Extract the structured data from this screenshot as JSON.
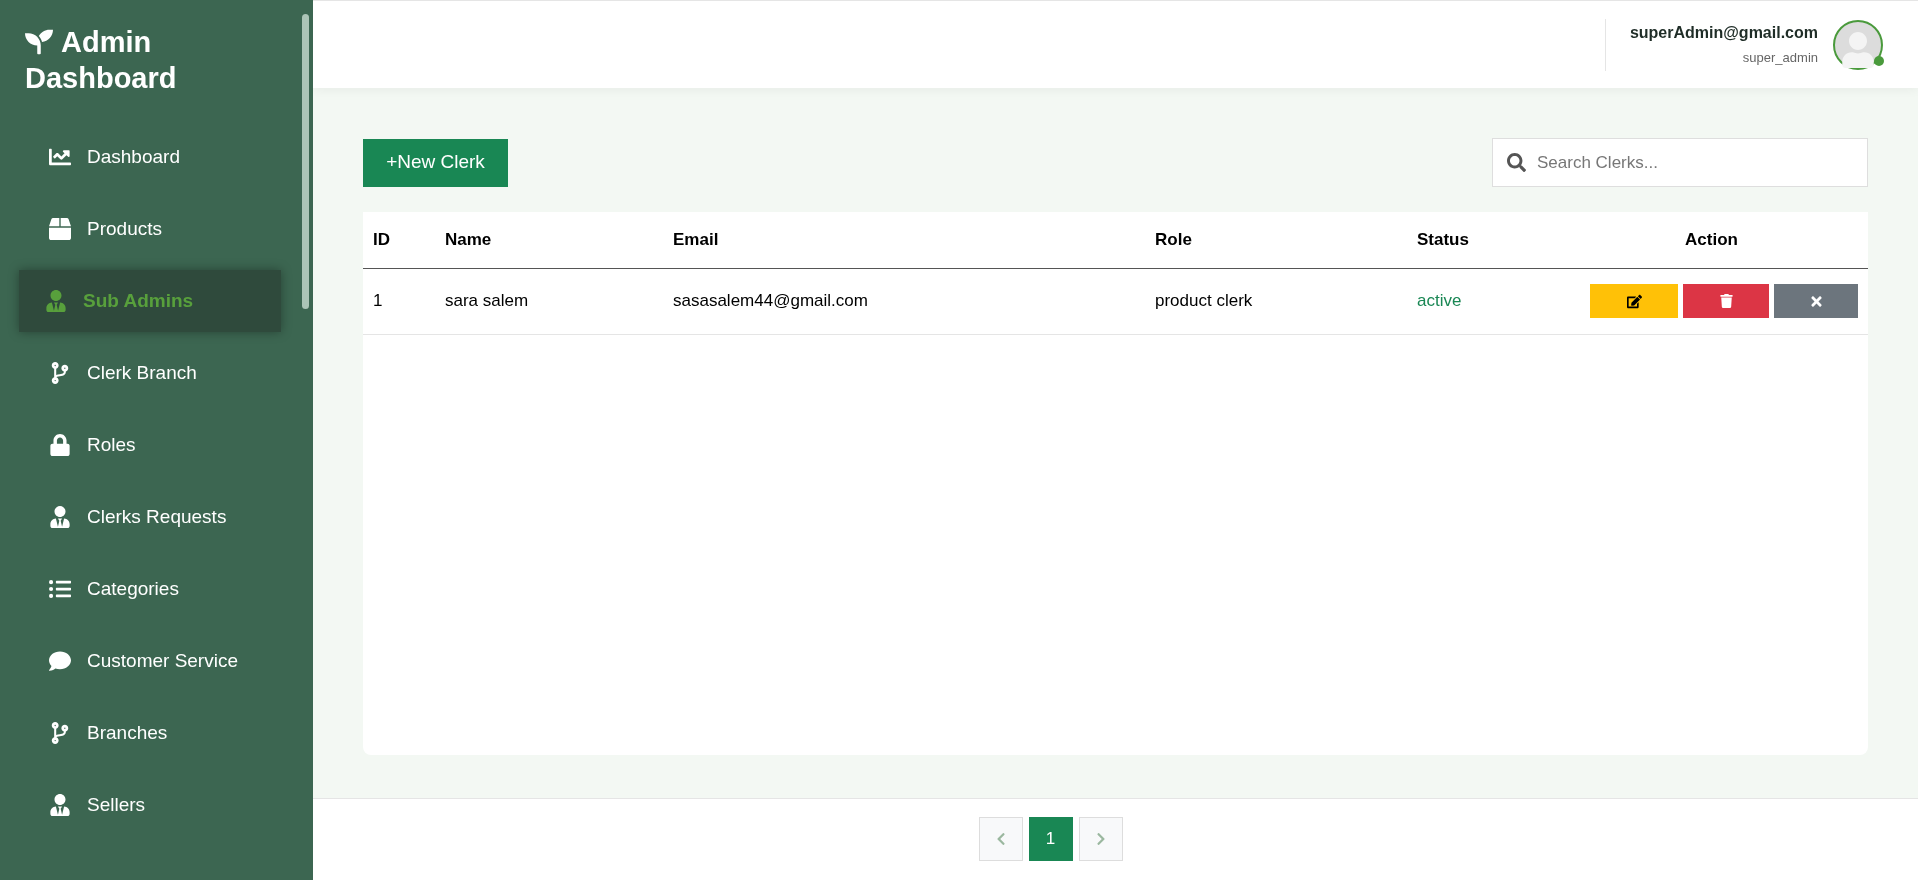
{
  "sidebar": {
    "title_lines": [
      "Admin",
      "Dashboard"
    ],
    "items": [
      {
        "label": "Dashboard",
        "selected": false
      },
      {
        "label": "Products",
        "selected": false
      },
      {
        "label": "Sub Admins",
        "selected": true
      },
      {
        "label": "Clerk Branch",
        "selected": false
      },
      {
        "label": "Roles",
        "selected": false
      },
      {
        "label": "Clerks Requests",
        "selected": false
      },
      {
        "label": "Categories",
        "selected": false
      },
      {
        "label": "Customer Service",
        "selected": false
      },
      {
        "label": "Branches",
        "selected": false
      },
      {
        "label": "Sellers",
        "selected": false
      }
    ]
  },
  "header": {
    "user_email": "superAdmin@gmail.com",
    "user_role": "super_admin",
    "online": true
  },
  "toolbar": {
    "new_button": "+New Clerk",
    "search": {
      "placeholder": "Search Clerks..."
    }
  },
  "table": {
    "columns": [
      "ID",
      "Name",
      "Email",
      "Role",
      "Status",
      "Action"
    ],
    "rows": [
      {
        "id": "1",
        "name": "sara salem",
        "email": "sasasalem44@gmail.com",
        "role": "product clerk",
        "status": "active"
      }
    ]
  },
  "pagination": {
    "pages": [
      {
        "label": "1",
        "selected": true
      }
    ]
  }
}
